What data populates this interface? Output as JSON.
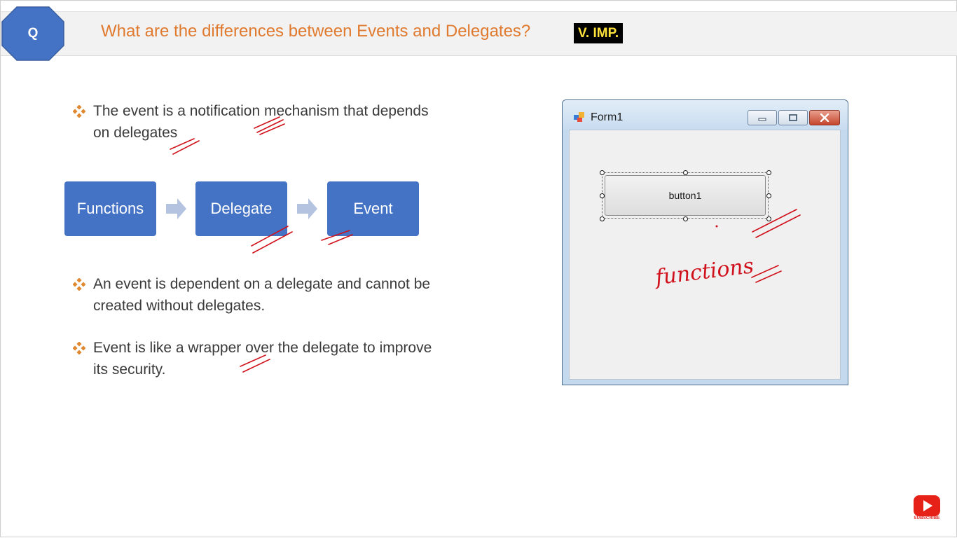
{
  "slide": {
    "q_label": "Q",
    "title": "What are the differences between Events and Delegates?",
    "importance_badge": "V. IMP.",
    "bullets": [
      {
        "line1": "The event is a notification mechanism that depends",
        "line2": "on delegates"
      },
      {
        "line1": "An event is dependent on a delegate and cannot be",
        "line2": "created without delegates."
      },
      {
        "line1": "Event is like a wrapper over the delegate to improve",
        "line2": "its security."
      }
    ],
    "flow": [
      "Functions",
      "Delegate",
      "Event"
    ]
  },
  "form_window": {
    "title": "Form1",
    "button_label": "button1"
  },
  "annotation": {
    "handwritten_word": "functions"
  },
  "subscribe": {
    "label": "SUBSCRIBE"
  },
  "colors": {
    "title_orange": "#e07a2e",
    "flow_blue": "#4472c4",
    "arrow_light": "#b4c4e0",
    "badge_yellow": "#ffe23a",
    "ink_red": "#d0101a"
  },
  "icons": [
    "diamond-bullet-icon",
    "arrow-right-icon",
    "form-app-icon",
    "minimize-icon",
    "maximize-icon",
    "close-icon",
    "youtube-play-icon"
  ]
}
